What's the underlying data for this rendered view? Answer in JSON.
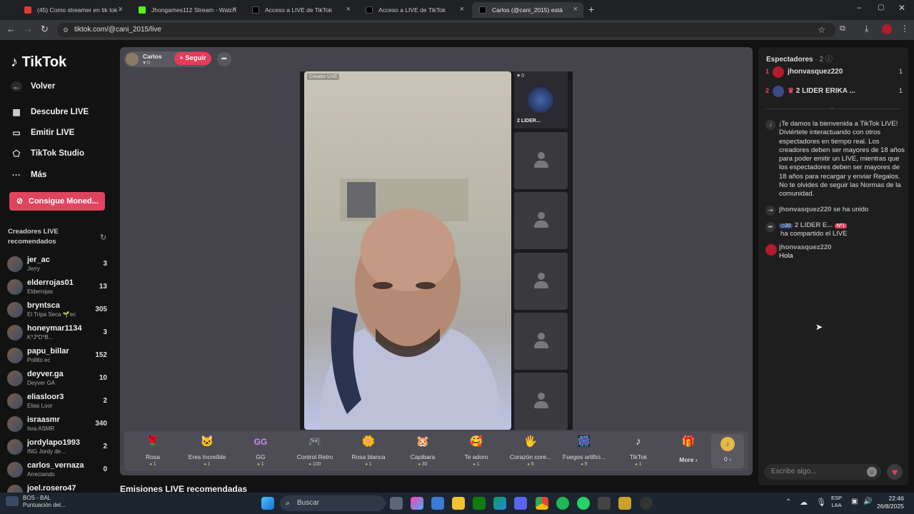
{
  "browser": {
    "tabs": [
      {
        "title": "(45) Como streamer en tik tok -",
        "color": "#e53935"
      },
      {
        "title": "Jhongames112 Stream - Watch",
        "color": "#53fc18"
      },
      {
        "title": "Acceso a LIVE de TikTok",
        "color": "#111111"
      },
      {
        "title": "Acceso a LIVE de TikTok",
        "color": "#111111"
      },
      {
        "title": "Carlos (@cani_2015) está",
        "color": "#111111"
      }
    ],
    "url": "tiktok.com/@cani_2015/live"
  },
  "sidebar": {
    "logo": "TikTok",
    "back": "Volver",
    "nav": [
      "Descubre LIVE",
      "Emitir LIVE",
      "TikTok Studio",
      "Más"
    ],
    "coins_button": "Consigue Moned...",
    "recommended_title": "Creadores LIVE recomendados",
    "creators": [
      {
        "name": "jer_ac",
        "sub": "Jerry",
        "count": "3"
      },
      {
        "name": "elderrojas01",
        "sub": "Elderrojas",
        "count": "13"
      },
      {
        "name": "bryntsca",
        "sub": "El Tripa Seca 🌱ec",
        "count": "305"
      },
      {
        "name": "honeymar1134",
        "sub": "K*J*D*B...",
        "count": "3"
      },
      {
        "name": "papu_billar",
        "sub": "Pollito ec",
        "count": "152"
      },
      {
        "name": "deyver.ga",
        "sub": "Deyver GA",
        "count": "10"
      },
      {
        "name": "eliasloor3",
        "sub": "Elias Loor",
        "count": "2"
      },
      {
        "name": "israasmr",
        "sub": "Isra ASMR",
        "count": "340"
      },
      {
        "name": "jordylapo1993",
        "sub": "ING Jordy de...",
        "count": "2"
      },
      {
        "name": "carlos_vernaza",
        "sub": "Arreciando",
        "count": "0"
      },
      {
        "name": "joel.rosero47",
        "sub": "",
        "count": ""
      }
    ]
  },
  "stage": {
    "host_name": "Carlos",
    "host_likes": "0",
    "follow": "+ Seguir",
    "creator_label": "Creador LIVE",
    "guest_likes": "0",
    "guest_name": "2 LIDER...",
    "gifts": [
      {
        "name": "Rosa",
        "price": "1",
        "icon": "🌹"
      },
      {
        "name": "Eres Increíble",
        "price": "1",
        "icon": "🐱"
      },
      {
        "name": "GG",
        "price": "1",
        "icon": "GG"
      },
      {
        "name": "Control Retro",
        "price": "100",
        "icon": "🎮"
      },
      {
        "name": "Rosa blanca",
        "price": "1",
        "icon": "🌼"
      },
      {
        "name": "Capibara",
        "price": "30",
        "icon": "🐹"
      },
      {
        "name": "Te adoro",
        "price": "1",
        "icon": "🥰"
      },
      {
        "name": "Corazón core...",
        "price": "5",
        "icon": "🖐"
      },
      {
        "name": "Fuegos artifici...",
        "price": "5",
        "icon": "🎆"
      },
      {
        "name": "TikTok",
        "price": "1",
        "icon": "♪"
      }
    ],
    "more": "More",
    "coin_count": "0"
  },
  "recommended_live": "Emisiones LIVE recomendadas",
  "panel": {
    "viewers_title": "Espectadores",
    "viewers_count": "· 2",
    "viewers": [
      {
        "rank": "1",
        "name": "jhonvasquez220",
        "score": "1"
      },
      {
        "rank": "2",
        "name": "2 LIDER ERIKA ...",
        "score": "1"
      }
    ],
    "welcome": "¡Te damos la bienvenida a TikTok LIVE! Diviértete interactuando con otros espectadores en tiempo real. Los creadores deben ser mayores de 18 años para poder emitir un LIVE, mientras que los espectadores deben ser mayores de 18 años para recargar y enviar Regalos. No te olvides de seguir las Normas de la comunidad.",
    "joined_user": "jhonvasquez220",
    "joined_text": "se ha unido",
    "share_badge": "20",
    "share_user": "2 LIDER E...",
    "share_rank": "Nº1",
    "share_text": "ha compartido el LIVE",
    "comment_user": "jhonvasquez220",
    "comment_text": "Hola",
    "chat_placeholder": "Escribe algo..."
  },
  "taskbar": {
    "weather_title": "BOS - BAL",
    "weather_sub": "Puntuación del...",
    "search": "Buscar",
    "lang1": "ESP",
    "lang2": "LAA",
    "time": "22:46",
    "date": "26/8/2025"
  }
}
